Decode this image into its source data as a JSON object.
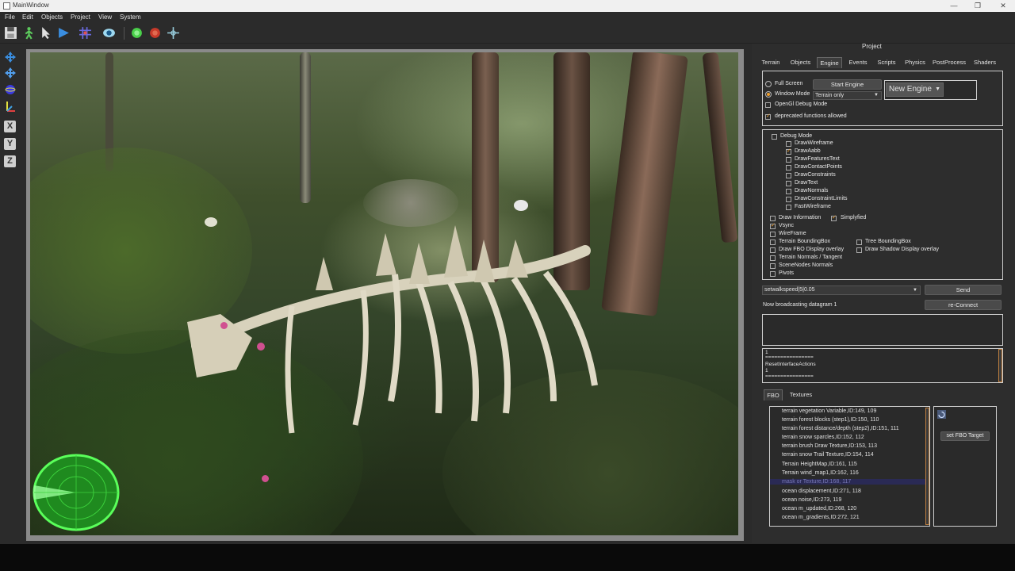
{
  "window": {
    "title": "MainWindow",
    "min_glyph": "—",
    "max_glyph": "❐",
    "close_glyph": "✕"
  },
  "menu": [
    "File",
    "Edit",
    "Objects",
    "Project",
    "View",
    "System"
  ],
  "toolbar": {
    "icons": [
      "save-icon",
      "character-icon",
      "pointer-icon",
      "play-icon",
      "grid-icon",
      "eye-icon",
      "green-orb-icon",
      "red-orb-icon",
      "crosshair-icon"
    ]
  },
  "lefttools": {
    "icons": [
      "move-icon",
      "move-alt-icon",
      "sphere-icon",
      "axes-icon"
    ],
    "axis_buttons": [
      "X",
      "Y",
      "Z"
    ]
  },
  "panel": {
    "title": "Project",
    "tabs": [
      "Terrain",
      "Objects",
      "Engine",
      "Events",
      "Scripts",
      "Physics",
      "PostProcess",
      "Shaders"
    ],
    "active_tab": "Engine",
    "engine": {
      "full_screen": "Full Screen",
      "window_mode": "Window Mode",
      "start_engine": "Start Engine",
      "terrain_select": "Terrain only",
      "new_engine": "New Engine",
      "opengl_debug": "OpenGl Debug Mode",
      "deprecated": "deprecated functions allowed"
    },
    "debug": {
      "debug_mode": "Debug Mode",
      "items": [
        {
          "label": "DrawWireframe",
          "checked": false
        },
        {
          "label": "DrawAabb",
          "checked": true
        },
        {
          "label": "DrawFeaturesText",
          "checked": false
        },
        {
          "label": "DrawContactPoints",
          "checked": false
        },
        {
          "label": "DrawConstraints",
          "checked": false
        },
        {
          "label": "DrawText",
          "checked": false
        },
        {
          "label": "DrawNormals",
          "checked": false
        },
        {
          "label": "DrawConstraintLimits",
          "checked": false
        },
        {
          "label": "FastWireframe",
          "checked": false
        }
      ],
      "draw_information": "Draw Information",
      "simplyfied": "Simplyfied",
      "vsync": "Vsync",
      "wireframe": "WireFrame",
      "terrain_bbox": "Terrain BoundingBox",
      "tree_bbox": "Tree BoundingBox",
      "fbo_overlay": "Draw FBO Display overlay",
      "shadow_overlay": "Draw Shadow Display overlay",
      "terrain_normals": "Terrain Normals / Tangent",
      "scenenodes_normals": "SceneNodes Normals",
      "pivots": "Pivots"
    },
    "network": {
      "command": "setwalkspeed|5|0.05",
      "send": "Send",
      "status": "Now broadcasting datagram 1",
      "reconnect": "re-Connect"
    },
    "log": [
      "1",
      "================",
      "ResetInterfaceActions",
      "1",
      "================"
    ],
    "fbo_tabs": [
      "FBO",
      "Textures"
    ],
    "fbo_items": [
      "terrain vegetation Variable,ID:149, 109",
      "terrain forest blocks (step1),ID:150, 110",
      "terrain forest distance/depth (step2),ID:151, 111",
      "terrain snow sparcles,ID:152, 112",
      "terrain brush Draw Texture,ID:153, 113",
      "terrain snow Trail Texture,ID:154, 114",
      "Terrain HeightMap,ID:161, 115",
      "Terrain wind_map1,ID:162, 116",
      "mask or Texture,ID:168, 117",
      "ocean displacement,ID:271, 118",
      "ocean noise,ID:273, 119",
      "ocean m_updated,ID:268, 120",
      "ocean m_gradients,ID:272, 121"
    ],
    "fbo_selected_index": 8,
    "set_fbo_target": "set FBO Target"
  },
  "colors": {
    "accent": "#f0a030",
    "radar": "#3cff3c"
  }
}
